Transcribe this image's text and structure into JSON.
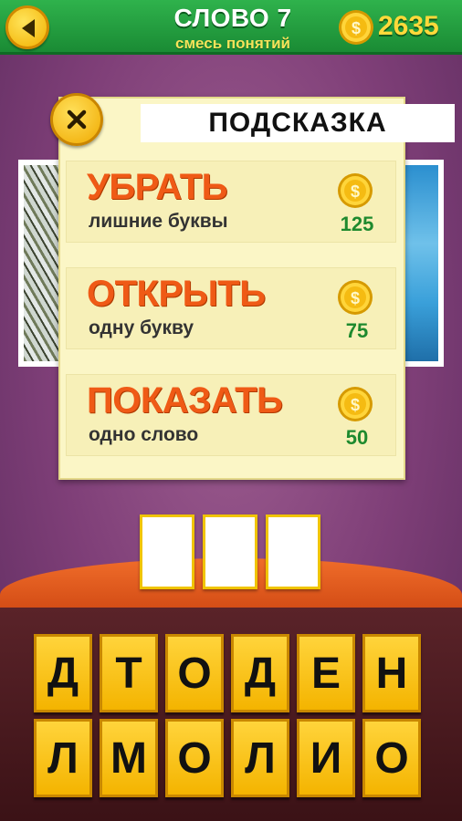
{
  "header": {
    "title": "СЛОВО 7",
    "subtitle": "смесь понятий",
    "coins": "2635"
  },
  "hint_panel": {
    "title": "ПОДСКАЗКА",
    "options": [
      {
        "title": "УБРАТЬ",
        "subtitle": "лишние буквы",
        "price": "125"
      },
      {
        "title": "ОТКРЫТЬ",
        "subtitle": "одну букву",
        "price": "75"
      },
      {
        "title": "ПОКАЗАТЬ",
        "subtitle": "одно слово",
        "price": "50"
      }
    ]
  },
  "answer_slots": [
    "",
    "",
    ""
  ],
  "letters": [
    [
      "Д",
      "Т",
      "О",
      "Д",
      "Е",
      "Н"
    ],
    [
      "Л",
      "М",
      "О",
      "Л",
      "И",
      "О"
    ]
  ],
  "colors": {
    "header_green": "#2fb24c",
    "coin_gold": "#f2b100",
    "option_orange": "#ef5a16",
    "price_green": "#1e8a2e",
    "background_purple": "#7f3f78"
  },
  "icons": {
    "back": "back-arrow-icon",
    "coin": "coin-icon",
    "close": "close-icon"
  }
}
